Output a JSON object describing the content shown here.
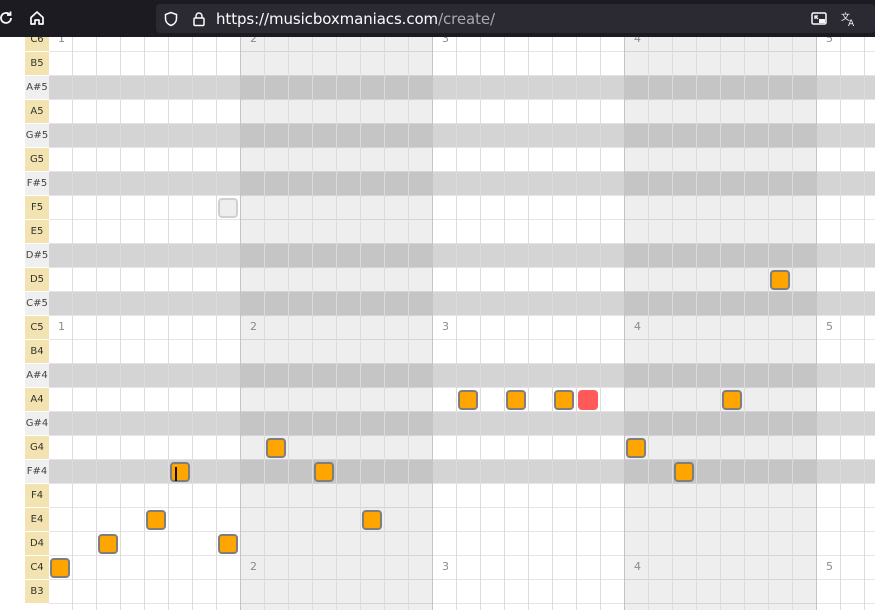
{
  "browser": {
    "url_host": "https://musicboxmaniacs.com",
    "url_path": "/create/",
    "icons": [
      "reload-icon",
      "home-icon",
      "shield-icon",
      "lock-icon",
      "picture-in-picture-icon",
      "translate-icon"
    ]
  },
  "piano_roll": {
    "pitches": [
      "C6",
      "B5",
      "A#5",
      "A5",
      "G#5",
      "G5",
      "F#5",
      "F5",
      "E5",
      "D#5",
      "D5",
      "C#5",
      "C5",
      "B4",
      "A#4",
      "A4",
      "G#4",
      "G4",
      "F#4",
      "F4",
      "E4",
      "D4",
      "C4",
      "B3"
    ],
    "measure_labels": [
      "1",
      "2",
      "3",
      "4",
      "5"
    ],
    "measure_label_rows": [
      "C6",
      "C5",
      "C4"
    ],
    "colors": {
      "note": "#ffa500",
      "note_border": "#7e7e7e",
      "selected_note": "#ff5a5a",
      "natural_key": "#f2e3b0",
      "sharp_row": "#d4d4d4"
    },
    "notes": [
      {
        "pitch": "C4",
        "beat": 0
      },
      {
        "pitch": "D4",
        "beat": 2
      },
      {
        "pitch": "E4",
        "beat": 4
      },
      {
        "pitch": "F#4",
        "beat": 5,
        "cursor": true
      },
      {
        "pitch": "D4",
        "beat": 7
      },
      {
        "pitch": "G4",
        "beat": 9
      },
      {
        "pitch": "F#4",
        "beat": 11
      },
      {
        "pitch": "E4",
        "beat": 13
      },
      {
        "pitch": "A4",
        "beat": 17
      },
      {
        "pitch": "A4",
        "beat": 19
      },
      {
        "pitch": "A4",
        "beat": 21
      },
      {
        "pitch": "A4",
        "beat": 22,
        "selected": true
      },
      {
        "pitch": "G4",
        "beat": 24
      },
      {
        "pitch": "F#4",
        "beat": 26
      },
      {
        "pitch": "A4",
        "beat": 28
      },
      {
        "pitch": "D5",
        "beat": 30
      },
      {
        "pitch": "F5",
        "beat": 7,
        "ghost": true
      }
    ]
  }
}
